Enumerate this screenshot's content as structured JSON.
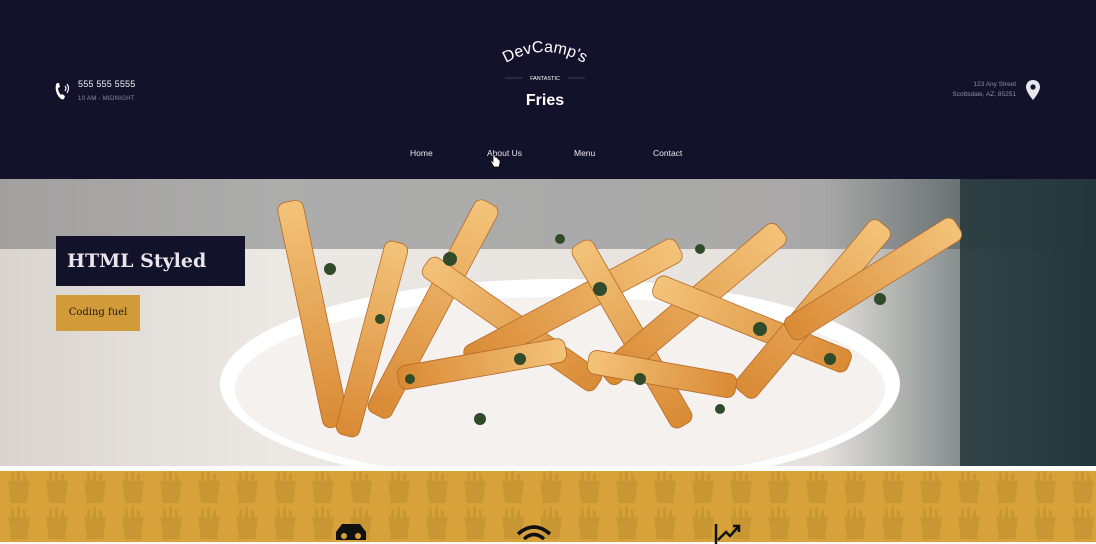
{
  "header": {
    "phone": "555 555 5555",
    "hours": "10 AM - MIDNIGHT",
    "logo": {
      "line1": "DevCamp's",
      "tag": "FANTASTIC",
      "line2": "Fries"
    },
    "address_line1": "123 Any Street",
    "address_line2": "Scottsdale, AZ, 85251"
  },
  "nav": [
    {
      "label": "Home"
    },
    {
      "label": "About Us"
    },
    {
      "label": "Menu"
    },
    {
      "label": "Contact"
    }
  ],
  "hero": {
    "title": "HTML Styled Fries",
    "badge": "Coding fuel"
  },
  "features": [
    {
      "icon": "delivery-truck-icon"
    },
    {
      "icon": "wifi-icon"
    },
    {
      "icon": "trending-chart-icon"
    }
  ],
  "colors": {
    "navy": "#13122b",
    "gold": "#d7a23a",
    "badge_gold": "#d29b3a"
  }
}
